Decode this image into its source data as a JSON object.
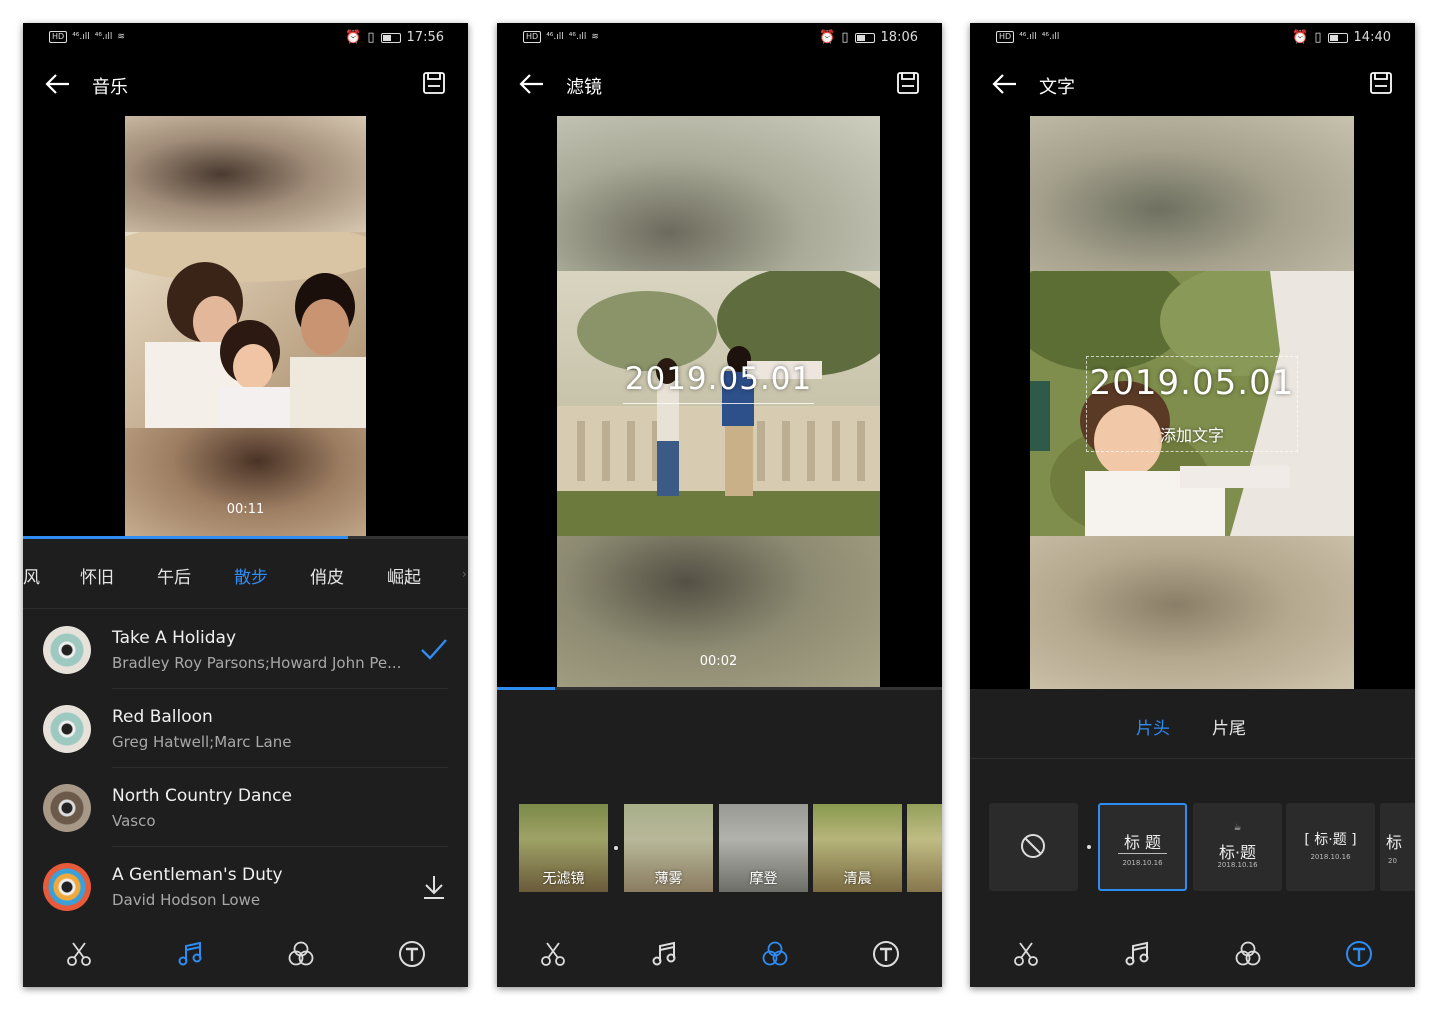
{
  "status": {
    "left": [
      "HD",
      "⁴⁶.ıll",
      "⁴⁶.ıll"
    ],
    "times": [
      "17:56",
      "18:06",
      "14:40"
    ]
  },
  "screens": [
    {
      "title": "音乐",
      "timecode": "00:11",
      "progress_fraction": 0.73,
      "tabs": [
        "风",
        "怀旧",
        "午后",
        "散步",
        "俏皮",
        "崛起"
      ],
      "active_tab": "散步",
      "songs": [
        {
          "name": "Take A Holiday",
          "artist": "Bradley Roy Parsons;Howard John Pe...",
          "state": "selected"
        },
        {
          "name": "Red Balloon",
          "artist": "Greg  Hatwell;Marc  Lane",
          "state": "none"
        },
        {
          "name": "North Country Dance",
          "artist": "Vasco",
          "state": "none"
        },
        {
          "name": "A Gentleman's Duty",
          "artist": "David Hodson Lowe",
          "state": "download"
        }
      ],
      "active_nav": "music"
    },
    {
      "title": "滤镜",
      "timecode": "00:02",
      "overlay_date": "2019.05.01",
      "progress_fraction": 0.13,
      "filters": [
        "无滤镜",
        "薄雾",
        "摩登",
        "清晨",
        ""
      ],
      "active_nav": "filter"
    },
    {
      "title": "文字",
      "overlay_date": "2019.05.01",
      "overlay_sub": "添加文字",
      "segments": [
        "片头",
        "片尾"
      ],
      "active_segment": "片头",
      "templates": [
        {
          "title": "",
          "date": ""
        },
        {
          "title": "标 题",
          "date": "2018.10.16"
        },
        {
          "title": "标·题",
          "date": "2018.10.16"
        },
        {
          "title": "[ 标·题 ]",
          "date": "2018.10.16"
        },
        {
          "title": "标",
          "date": "20"
        }
      ],
      "active_nav": "text"
    }
  ],
  "colors": {
    "accent": "#2f8cf3",
    "panel": "#1e1e1e",
    "background": "#000000"
  },
  "nav_icons": [
    "scissors-icon",
    "music-note-icon",
    "filter-circles-icon",
    "text-t-icon"
  ]
}
